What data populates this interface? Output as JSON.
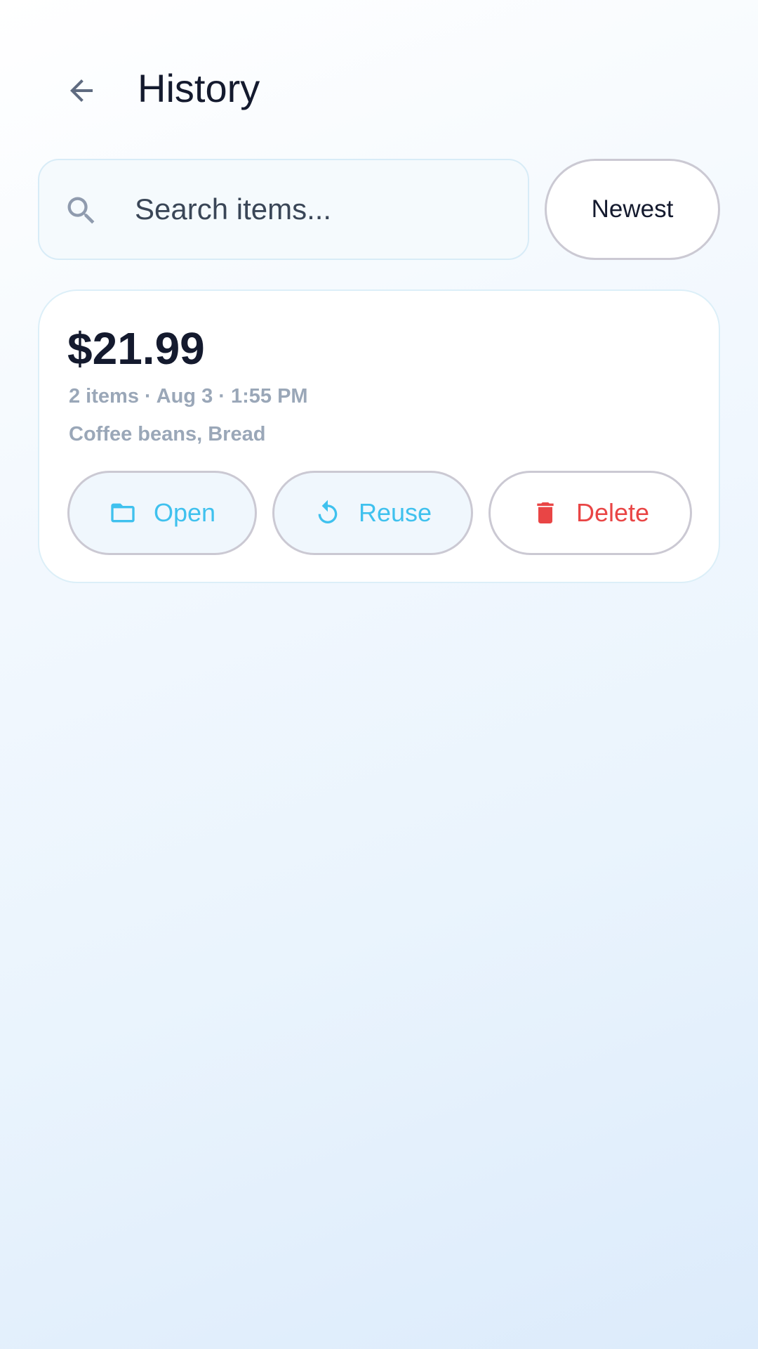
{
  "header": {
    "title": "History",
    "back_icon": "arrow-left-icon"
  },
  "search": {
    "placeholder": "Search items...",
    "value": "",
    "icon": "search-icon"
  },
  "sort": {
    "label": "Newest"
  },
  "history": [
    {
      "amount": "$21.99",
      "meta": "2 items · Aug 3 · 1:55 PM",
      "items": "Coffee beans, Bread",
      "actions": {
        "open_label": "Open",
        "reuse_label": "Reuse",
        "delete_label": "Delete"
      }
    }
  ],
  "colors": {
    "accent": "#3fc1ee",
    "danger": "#e94545",
    "text": "#141a2e",
    "muted": "#9aa7b8"
  }
}
